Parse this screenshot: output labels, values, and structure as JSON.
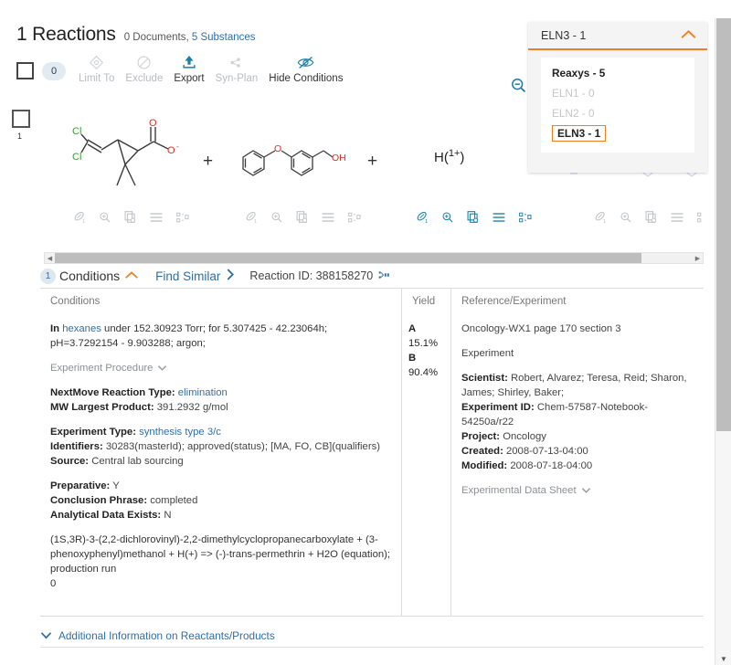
{
  "header": {
    "count_title": "1 Reactions",
    "sub_documents": "0 Documents,",
    "sub_substances": "5 Substances",
    "selected_count": "0",
    "buttons": [
      {
        "label": "Limit To",
        "icon": "limit-to-icon",
        "enabled": false
      },
      {
        "label": "Exclude",
        "icon": "exclude-icon",
        "enabled": false
      },
      {
        "label": "Export",
        "icon": "export-icon",
        "enabled": true
      },
      {
        "label": "Syn-Plan",
        "icon": "syn-plan-icon",
        "enabled": false
      },
      {
        "label": "Hide Conditions",
        "icon": "hide-conditions-icon",
        "enabled": true
      }
    ],
    "search_icon": "zoom-out-icon"
  },
  "dropdown": {
    "selected_label": "ELN3 - 1",
    "chevron": "chevron-up-icon",
    "options": [
      {
        "label": "Reaxys - 5",
        "state": "enabled"
      },
      {
        "label": "ELN1 - 0",
        "state": "disabled"
      },
      {
        "label": "ELN2 - 0",
        "state": "disabled"
      },
      {
        "label": "ELN3 - 1",
        "state": "selected"
      }
    ]
  },
  "reaction": {
    "row_number": "1",
    "plus_1": "+",
    "plus_2": "+",
    "reactant3_label": "H(1+)",
    "structure_icons": [
      "substance-icon",
      "zoom-in-icon",
      "copy-structure-icon",
      "details-icon",
      "properties-icon"
    ],
    "molecule1_atoms": [
      "Cl",
      "Cl",
      "O",
      "O-"
    ],
    "molecule2_atoms": [
      "O",
      "OH"
    ]
  },
  "conditions_bar": {
    "badge": "1",
    "label": "Conditions",
    "chevron": "chevron-up-icon",
    "find_similar": "Find Similar",
    "find_similar_chevron": "chevron-right-icon",
    "reaction_id": "Reaction ID: 388158270"
  },
  "table": {
    "headers": {
      "conditions": "Conditions",
      "yield": "Yield",
      "reference": "Reference/Experiment"
    },
    "conditions": {
      "line_in": "In",
      "solvent": "hexanes",
      "line_rest": "under 152.30923 Torr; for 5.307425 - 42.23064h; pH=3.7292154 - 9.903288; argon;",
      "experiment_procedure": "Experiment Procedure",
      "fields": [
        {
          "label": "NextMove Reaction Type:",
          "value": "elimination"
        },
        {
          "label": "MW Largest Product:",
          "value": "391.2932 g/mol"
        }
      ],
      "fields2": [
        {
          "label": "Experiment Type:",
          "value": "synthesis type 3/c"
        },
        {
          "label": "Identifiers:",
          "value": "30283(masterId); approved(status); [MA, FO, CB](qualifiers)"
        },
        {
          "label": "Source:",
          "value": "Central lab sourcing"
        }
      ],
      "fields3": [
        {
          "label": "Preparative:",
          "value": "Y"
        },
        {
          "label": "Conclusion Phrase:",
          "value": "completed"
        },
        {
          "label": "Analytical Data Exists:",
          "value": "N"
        }
      ],
      "equation": "(1S,3R)-3-(2,2-dichlorovinyl)-2,2-dimethylcyclopropanecarboxylate + (3-phenoxyphenyl)methanol + H(+) => (-)-trans-permethrin + H2O (equation);",
      "production_run": "production run",
      "trailing": "0"
    },
    "yield": [
      {
        "label": "A",
        "value": "15.1%"
      },
      {
        "label": "B",
        "value": "90.4%"
      }
    ],
    "reference": {
      "citation": "Oncology-WX1 page 170 section 3",
      "experiment_heading": "Experiment",
      "fields": [
        {
          "label": "Scientist:",
          "value": "Robert, Alvarez; Teresa, Reid; Sharon, James; Shirley, Baker;"
        },
        {
          "label": "Experiment ID:",
          "value": "Chem-57587-Notebook-54250a/r22"
        },
        {
          "label": "Project:",
          "value": "Oncology"
        },
        {
          "label": "Created:",
          "value": "2008-07-13-04:00"
        },
        {
          "label": "Modified:",
          "value": "2008-07-18-04:00"
        }
      ],
      "data_sheet": "Experimental Data Sheet"
    }
  },
  "footer": {
    "chevron": "chevron-down-icon",
    "label": "Additional Information on Reactants/Products"
  },
  "scrollbars": {
    "horizontal_left_arrow": "◀",
    "horizontal_right_arrow": "▶",
    "vertical_down_arrow": "▼"
  },
  "colors": {
    "accent_orange": "#ef8021",
    "link_blue": "#2f6fa8",
    "teal": "#1b7fa8",
    "chlorine_green": "#3a9b3a",
    "oxygen_red": "#d93025"
  }
}
